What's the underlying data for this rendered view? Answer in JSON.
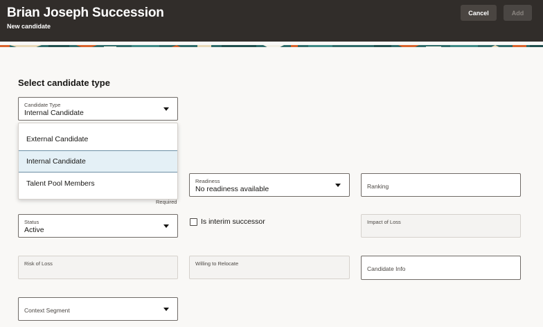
{
  "header": {
    "title": "Brian Joseph Succession",
    "subtitle": "New candidate",
    "cancel_label": "Cancel",
    "add_label": "Add"
  },
  "section_title": "Select candidate type",
  "candidate_type": {
    "label": "Candidate Type",
    "value": "Internal Candidate",
    "options": [
      "External Candidate",
      "Internal Candidate",
      "Talent Pool Members"
    ],
    "selected_option": "Internal Candidate"
  },
  "required_text": "Required",
  "readiness": {
    "label": "Readiness",
    "value": "No readiness available"
  },
  "ranking": {
    "placeholder": "Ranking"
  },
  "status": {
    "label": "Status",
    "value": "Active"
  },
  "interim": {
    "label": "Is interim successor",
    "checked": false
  },
  "impact_of_loss": {
    "label": "Impact of Loss"
  },
  "risk_of_loss": {
    "label": "Risk of Loss"
  },
  "willing_to_relocate": {
    "label": "Willing to Relocate"
  },
  "candidate_info": {
    "placeholder": "Candidate  Info"
  },
  "context_segment": {
    "placeholder": "Context Segment"
  },
  "colors": {
    "header_bg": "#312d2a",
    "page_bg": "#f9f8f6",
    "selected_option_bg": "#e4f0f6",
    "banner_teal": "#2e6b69",
    "banner_orange": "#d9632b"
  }
}
